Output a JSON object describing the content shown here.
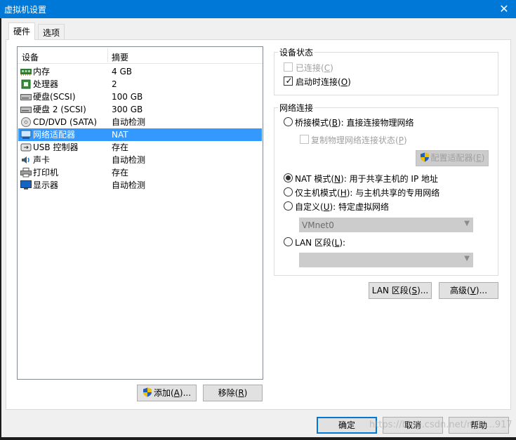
{
  "window": {
    "title": "虚拟机设置",
    "close_symbol": "✕"
  },
  "tabs": [
    {
      "label": "硬件",
      "active": true
    },
    {
      "label": "选项",
      "active": false
    }
  ],
  "device_list": {
    "columns": [
      "设备",
      "摘要"
    ],
    "rows": [
      {
        "name": "内存",
        "summary": "4 GB",
        "icon": "memory-icon"
      },
      {
        "name": "处理器",
        "summary": "2",
        "icon": "processor-icon"
      },
      {
        "name": "硬盘(SCSI)",
        "summary": "100 GB",
        "icon": "hard-disk-icon"
      },
      {
        "name": "硬盘 2 (SCSI)",
        "summary": "300 GB",
        "icon": "hard-disk-icon"
      },
      {
        "name": "CD/DVD (SATA)",
        "summary": "自动检测",
        "icon": "cd-dvd-icon"
      },
      {
        "name": "网络适配器",
        "summary": "NAT",
        "icon": "network-adapter-icon",
        "selected": true
      },
      {
        "name": "USB 控制器",
        "summary": "存在",
        "icon": "usb-icon"
      },
      {
        "name": "声卡",
        "summary": "自动检测",
        "icon": "sound-card-icon"
      },
      {
        "name": "打印机",
        "summary": "存在",
        "icon": "printer-icon"
      },
      {
        "name": "显示器",
        "summary": "自动检测",
        "icon": "display-icon"
      }
    ],
    "add_button": {
      "text": "添加",
      "key": "A",
      "suffix": "..."
    },
    "remove_button": {
      "text": "移除",
      "key": "R",
      "suffix": ""
    }
  },
  "device_status": {
    "title": "设备状态",
    "connected": {
      "text": "已连接",
      "key": "C",
      "checked": false,
      "enabled": false
    },
    "connect_at_power_on": {
      "text": "启动时连接",
      "key": "O",
      "checked": true,
      "enabled": true
    }
  },
  "network_connection": {
    "title": "网络连接",
    "bridged": {
      "prefix": "桥接模式(",
      "key": "B",
      "suffix": "): 直接连接物理网络",
      "selected": false
    },
    "replicate_state": {
      "prefix": "复制物理网络连接状态(",
      "key": "P",
      "suffix": ")",
      "checked": false,
      "enabled": false
    },
    "configure_adapters": {
      "text": "配置适配器",
      "key": "E"
    },
    "nat": {
      "prefix": "NAT 模式(",
      "key": "N",
      "suffix": "): 用于共享主机的 IP 地址",
      "selected": true
    },
    "host_only": {
      "prefix": "仅主机模式(",
      "key": "H",
      "suffix": "): 与主机共享的专用网络",
      "selected": false
    },
    "custom": {
      "prefix": "自定义(",
      "key": "U",
      "suffix": "): 特定虚拟网络",
      "selected": false
    },
    "custom_network_value": "VMnet0",
    "lan_segment": {
      "prefix": "LAN 区段(",
      "key": "L",
      "suffix": "):",
      "selected": false
    },
    "lan_segment_value": ""
  },
  "right_buttons": {
    "lan_segments": {
      "prefix": "LAN 区段(",
      "key": "S",
      "suffix": ")..."
    },
    "advanced": {
      "prefix": "高级(",
      "key": "V",
      "suffix": ")..."
    }
  },
  "footer": {
    "ok": "确定",
    "cancel": "取消",
    "help": "帮助",
    "watermark": "https://blog.csdn.net/m0_...917"
  },
  "colors": {
    "title_bar": "#0078d7",
    "selection": "#3399ff",
    "accent_border": "#0078d7"
  }
}
